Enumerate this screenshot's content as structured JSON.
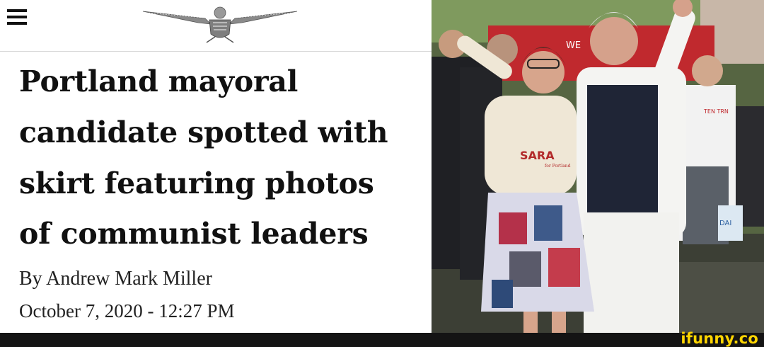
{
  "article": {
    "headline_lines": [
      "Portland mayoral",
      "candidate spotted with",
      "skirt featuring photos",
      "of communist leaders"
    ],
    "byline": "By Andrew Mark Miller",
    "date": "October 7, 2020 - 12:27 PM"
  },
  "photo": {
    "shirt_text": "SARA",
    "shirt_subtext": "for Portland",
    "banner_letters": "WE",
    "tshirt_right": "TEN TRN",
    "poster_letters": "DAI"
  },
  "watermark": "ifunny.co",
  "icons": {
    "menu": "hamburger-menu-icon",
    "logo": "eagle-masthead-logo"
  },
  "colors": {
    "footer": "#141414",
    "watermark": "#ffd500",
    "banner": "#c0292e"
  }
}
